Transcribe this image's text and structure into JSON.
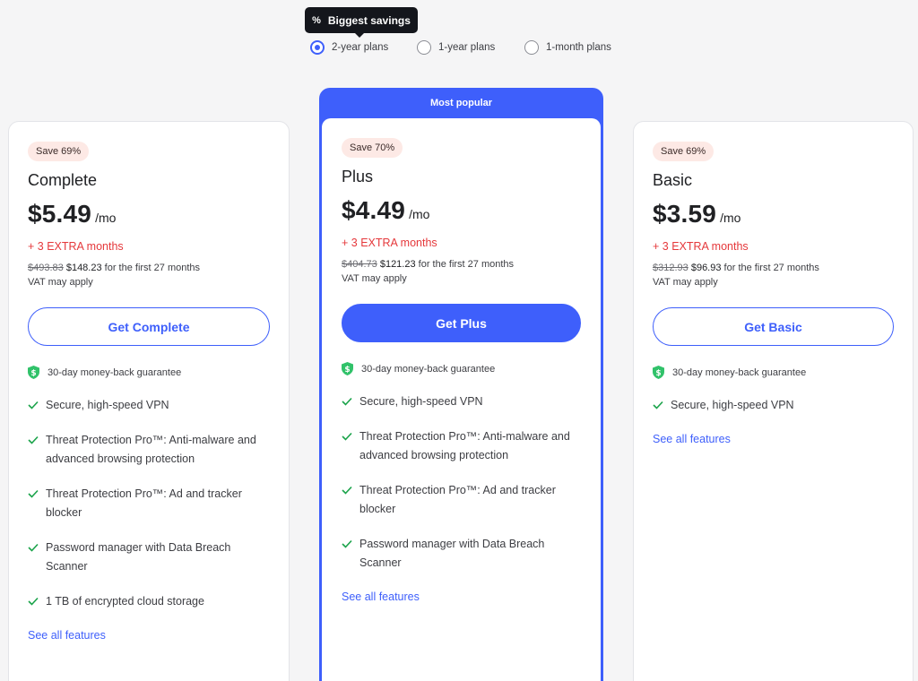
{
  "billing_period": {
    "tooltip": "Biggest savings",
    "tooltip_icon": "percent-icon",
    "options": [
      {
        "label": "2-year plans",
        "selected": true
      },
      {
        "label": "1-year plans",
        "selected": false
      },
      {
        "label": "1-month plans",
        "selected": false
      }
    ]
  },
  "colors": {
    "accent": "#3e5ffb",
    "extra_months": "#e5383b",
    "save_badge_bg": "#fde9e5",
    "check": "#1aa34a",
    "shield": "#31c26a"
  },
  "plans": {
    "complete": {
      "save": "Save 69%",
      "name": "Complete",
      "price": "$5.49",
      "per": "/mo",
      "extra": "+ 3 EXTRA months",
      "old_price": "$493.83",
      "new_price": "$148.23",
      "period_text": "for the first 27 months",
      "vat": "VAT may apply",
      "cta": "Get Complete",
      "guarantee": "30-day money-back guarantee",
      "features": [
        "Secure, high-speed VPN",
        "Threat Protection Pro™: Anti-malware and advanced browsing protection",
        "Threat Protection Pro™: Ad and tracker blocker",
        "Password manager with Data Breach Scanner",
        "1 TB of encrypted cloud storage"
      ],
      "see_all": "See all features"
    },
    "plus": {
      "popular": "Most popular",
      "save": "Save 70%",
      "name": "Plus",
      "price": "$4.49",
      "per": "/mo",
      "extra": "+ 3 EXTRA months",
      "old_price": "$404.73",
      "new_price": "$121.23",
      "period_text": "for the first 27 months",
      "vat": "VAT may apply",
      "cta": "Get Plus",
      "guarantee": "30-day money-back guarantee",
      "features": [
        "Secure, high-speed VPN",
        "Threat Protection Pro™: Anti-malware and advanced browsing protection",
        "Threat Protection Pro™: Ad and tracker blocker",
        "Password manager with Data Breach Scanner"
      ],
      "see_all": "See all features"
    },
    "basic": {
      "save": "Save 69%",
      "name": "Basic",
      "price": "$3.59",
      "per": "/mo",
      "extra": "+ 3 EXTRA months",
      "old_price": "$312.93",
      "new_price": "$96.93",
      "period_text": "for the first 27 months",
      "vat": "VAT may apply",
      "cta": "Get Basic",
      "guarantee": "30-day money-back guarantee",
      "features": [
        "Secure, high-speed VPN"
      ],
      "see_all": "See all features"
    }
  }
}
